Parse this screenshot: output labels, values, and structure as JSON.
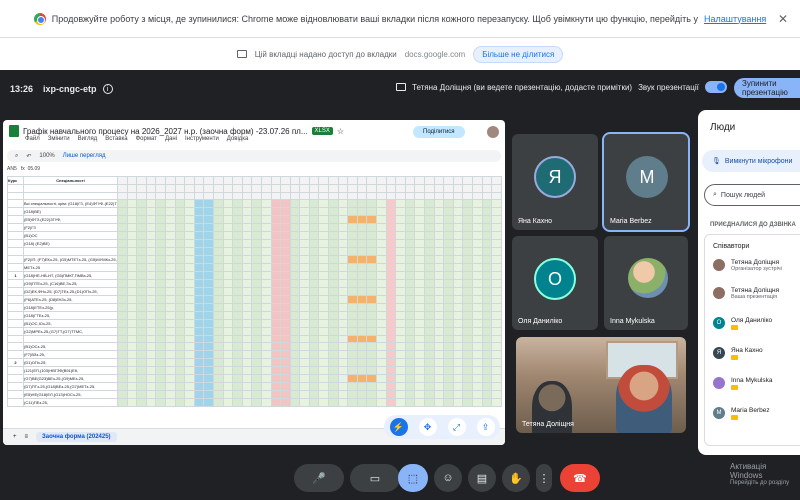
{
  "chrome": {
    "restore_text": "Продовжуйте роботу з місця, де зупинилися: Chrome може відновлювати ваші вкладки після кожного перезапуску. Щоб увімкнути цю функцію, перейдіть у",
    "settings_link": "Налаштування",
    "share_text": "Цій вкладці надано доступ до вкладки",
    "share_site": "docs.google.com",
    "stop_share": "Більше не ділитися"
  },
  "meet": {
    "time": "13:26",
    "code": "ixp-cngc-etp",
    "presenting_text": "Тетяна Доліщня (ви ведете презентацію, додасте примітки)",
    "sound_label": "Звук презентації",
    "stop_present": "Зупинити презентацію"
  },
  "sheet": {
    "title": "Графік навчального процесу на 2026_2027 н.р. (заочна форм) -23.07.26 пл...",
    "badge": "XLSX",
    "menu": [
      "Файл",
      "Змінити",
      "Вигляд",
      "Вставка",
      "Формат",
      "Дані",
      "Інструменти",
      "Довідка"
    ],
    "share_label": "Поділитися",
    "zoom": "100%",
    "mode": "Лише перегляд",
    "cell_ref": "AN5",
    "formula": "05.09",
    "col_course": "Курс",
    "col_spec": "Спеціальності",
    "tab_label": "Заочна форма (202425)",
    "specialties": [
      "Всі спеціальності, крім: (G18)ГЗ, (Е4)ФГУФ-(Е22)ТЗ-(Е3)ОС-(Е5)ВЕ,",
      "(G18)ВЕ)",
      "(Е5)ФГЗ-(Е22)ЗГУФ,",
      "(F2)ГЗ",
      "(В1)ОС",
      "(G18) (Е2)ВЕ)",
      "",
      "(F2)ІП, (F7)ЕКз-25, (G5)МТЕТз-25, (G5)МУМКз-25,(С1)ЕК,(G7)МТ,",
      "МЕТз-25",
      "(G18)НЕ-НВ-НТ, (G5)ПМКТ,ПМВз-25,",
      "(G9)ПТЕз-25, (С16)ВЕ,Зз-25,",
      "(D2)ЕК,ФНз-25, (D7)ТЕз-25,(D1)ОПз-25,",
      "(F6)АТЕз-25, (D8)ЕКЗз-25,",
      "(G18)ЕТЕз-25(у,",
      "(G18)ГТЕз-25,",
      "(В1)ОС,ІОз-25,",
      "(G2)МРЕз-25,(G7)ТТ,(G7)ТТМС,",
      "",
      "(В1)ОСз-25,",
      "(F7)ВЗз-25,",
      "(D1)ОПз-25,",
      "(121)ЕП,(103)НВГЗФ(В91)ЕК,",
      "(G7)ВЕ(G23)ВЕз-25,(G9)МЕз-25,",
      "(D7)ПТз-25,(G18)ВЕз-25,(G7)МЕТз-25,",
      "(Е5)НЕ(G18)ЕЛ,(G13)НОСз-25,",
      "(С11)ПЕз-25,"
    ],
    "course_numbers": [
      "",
      "",
      "",
      "",
      "",
      "",
      "",
      "",
      "",
      "1",
      "",
      "",
      "",
      "",
      "",
      "",
      "",
      "",
      "",
      "",
      "2",
      "",
      "",
      "",
      "",
      "",
      "3",
      "",
      ""
    ]
  },
  "participants": [
    {
      "name": "Яна Кахно",
      "initial": "Я",
      "color": "#1e6b74"
    },
    {
      "name": "Maria Berbez",
      "initial": "M",
      "color": "#607d8b"
    },
    {
      "name": "Оля Даниліко",
      "initial": "О",
      "color": "#00838f"
    },
    {
      "name": "Inna Mykulska",
      "initial": "",
      "color": "#80cbc4"
    },
    {
      "name": "Тетяна Доліщня",
      "initial": "",
      "color": "#c62828"
    }
  ],
  "people_panel": {
    "title": "Люди",
    "mic_button": "Вимкнути мікрофони",
    "search_placeholder": "Пошук людей",
    "section_label": "ПРИЄДНАЛИСЯ ДО ДЗВІНКА",
    "group_label": "Співавтори",
    "members": [
      {
        "name": "Тетяна Доліщня",
        "sub": "Організатор зустрічі",
        "color": "#8d6e63"
      },
      {
        "name": "Тетяна Доліщня",
        "sub": "Ваша презентація",
        "color": "#8d6e63"
      },
      {
        "name": "Оля Даниліко",
        "sub": "",
        "color": "#00838f"
      },
      {
        "name": "Яна Кахно",
        "sub": "",
        "color": "#37474f"
      },
      {
        "name": "Inna Mykulska",
        "sub": "",
        "color": "#9575cd"
      },
      {
        "name": "Maria Berbez",
        "sub": "",
        "color": "#607d8b"
      }
    ]
  },
  "activation": {
    "title": "Активація Windows",
    "sub": "Перейдіть до розділу"
  }
}
